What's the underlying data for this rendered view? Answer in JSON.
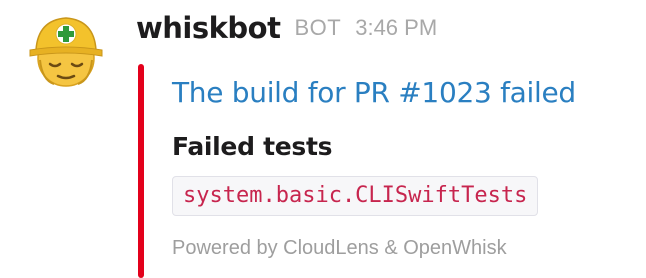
{
  "message": {
    "avatar_icon": "hard-hat-worker-emoji-icon",
    "sender": "whiskbot",
    "bot_tag": "BOT",
    "timestamp": "3:46 PM"
  },
  "attachment": {
    "accent_color": "#e3001b",
    "title": "The build for PR #1023 failed",
    "field_title": "Failed tests",
    "field_value": "system.basic.CLISwiftTests",
    "footer": "Powered by CloudLens & OpenWhisk"
  }
}
